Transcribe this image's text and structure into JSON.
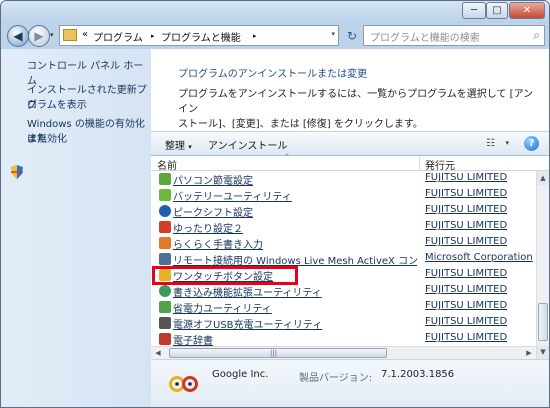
{
  "titlebar": {
    "minimize": "─",
    "maximize": "□",
    "close": "✕"
  },
  "nav": {
    "back_icon": "arrow-left",
    "forward_icon": "arrow-right",
    "prefix": "«",
    "breadcrumb": [
      "プログラム",
      "プログラムと機能"
    ],
    "separator": "▸",
    "dropdown": "▾",
    "refresh": "↻",
    "search_placeholder": "プログラムと機能の検索",
    "search_icon": "⌕"
  },
  "sidebar": {
    "items": [
      {
        "label": "コントロール パネル ホーム"
      },
      {
        "label": "インストールされた更新プロ"
      },
      {
        "label": "グラムを表示"
      },
      {
        "label": "Windows の機能の有効化また"
      },
      {
        "label": "は無効化"
      }
    ]
  },
  "main": {
    "heading": "プログラムのアンインストールまたは変更",
    "description_line1": "プログラムをアンインストールするには、一覧からプログラムを選択して [アンイン",
    "description_line2": "ストール]、[変更]、または [修復] をクリックします。"
  },
  "toolbar": {
    "organize": "整理",
    "uninstall": "アンインストール",
    "view_icon": "☷",
    "help": "?"
  },
  "list": {
    "col_name": "名前",
    "col_publisher": "発行元",
    "sort_indicator": "^",
    "rows": [
      {
        "name": "パソコン節電設定",
        "publisher": "FUJITSU LIMITED",
        "color": "#5ea83a"
      },
      {
        "name": "バッテリーユーティリティ",
        "publisher": "FUJITSU LIMITED",
        "color": "#6db83f"
      },
      {
        "name": "ピークシフト設定",
        "publisher": "FUJITSU LIMITED",
        "color": "#1d5fb0"
      },
      {
        "name": "ゆったり設定２",
        "publisher": "FUJITSU LIMITED",
        "color": "#d43c2c"
      },
      {
        "name": "らくらく手書き入力",
        "publisher": "FUJITSU LIMITED",
        "color": "#e07a28"
      },
      {
        "name": "リモート接続用の Windows Live Mesh ActiveX コントロ...",
        "publisher": "Microsoft Corporation",
        "color": "#4d6f99"
      },
      {
        "name": "ワンタッチボタン設定",
        "publisher": "FUJITSU LIMITED",
        "color": "#e6b422"
      },
      {
        "name": "書き込み機能拡張ユーティリティ",
        "publisher": "FUJITSU LIMITED",
        "color": "#3c9a5f"
      },
      {
        "name": "省電力ユーティリティ",
        "publisher": "FUJITSU LIMITED",
        "color": "#4fa34a"
      },
      {
        "name": "電源オフUSB充電ユーティリティ",
        "publisher": "FUJITSU LIMITED",
        "color": "#555555"
      },
      {
        "name": "電子辞書",
        "publisher": "FUJITSU LIMITED",
        "color": "#c0392b"
      }
    ]
  },
  "scroll": {
    "up": "▲",
    "down": "▼",
    "left": "◀",
    "right": "▶",
    "grip": "|||"
  },
  "details": {
    "company": "Google Inc.",
    "version_label": "製品バージョン:",
    "version": "7.1.2003.1856",
    "logo": "Google"
  },
  "colors": {
    "highlight": "#e8001c",
    "link": "#15345c"
  }
}
